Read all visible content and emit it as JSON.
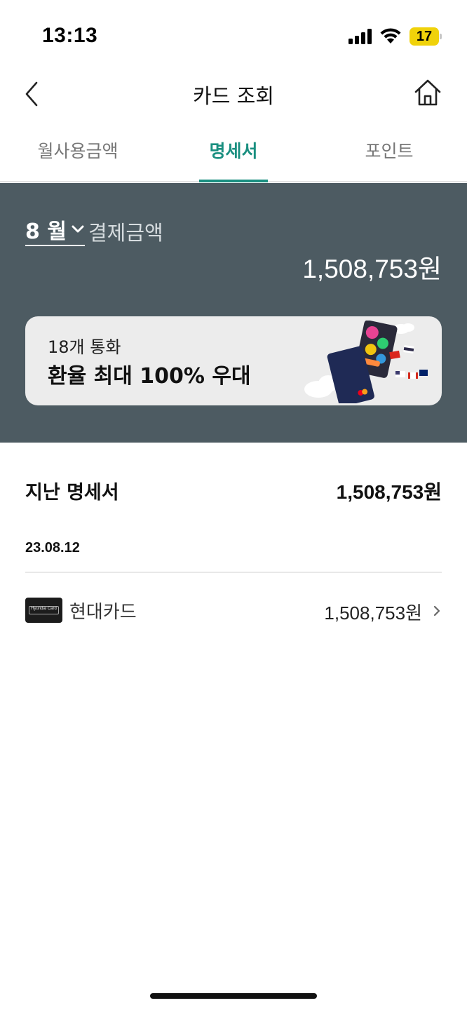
{
  "status_bar": {
    "time": "13:13",
    "battery": "17"
  },
  "header": {
    "title": "카드 조회"
  },
  "tabs": [
    {
      "label": "월사용금액",
      "active": false
    },
    {
      "label": "명세서",
      "active": true
    },
    {
      "label": "포인트",
      "active": false
    }
  ],
  "summary": {
    "month": "8 월",
    "payment_label": "결제금액",
    "payment_amount": "1,508,753원",
    "banner": {
      "subtitle": "18개 통화",
      "title": "환율 최대 100% 우대"
    }
  },
  "statement": {
    "title": "지난 명세서",
    "total": "1,508,753원",
    "date": "23.08.12",
    "items": [
      {
        "card_logo_text": "Hyundai Card",
        "card_name": "현대카드",
        "amount": "1,508,753원"
      }
    ]
  },
  "colors": {
    "accent": "#1a8f80",
    "summary_bg": "#4d5b62",
    "banner_bg": "#ececec"
  }
}
